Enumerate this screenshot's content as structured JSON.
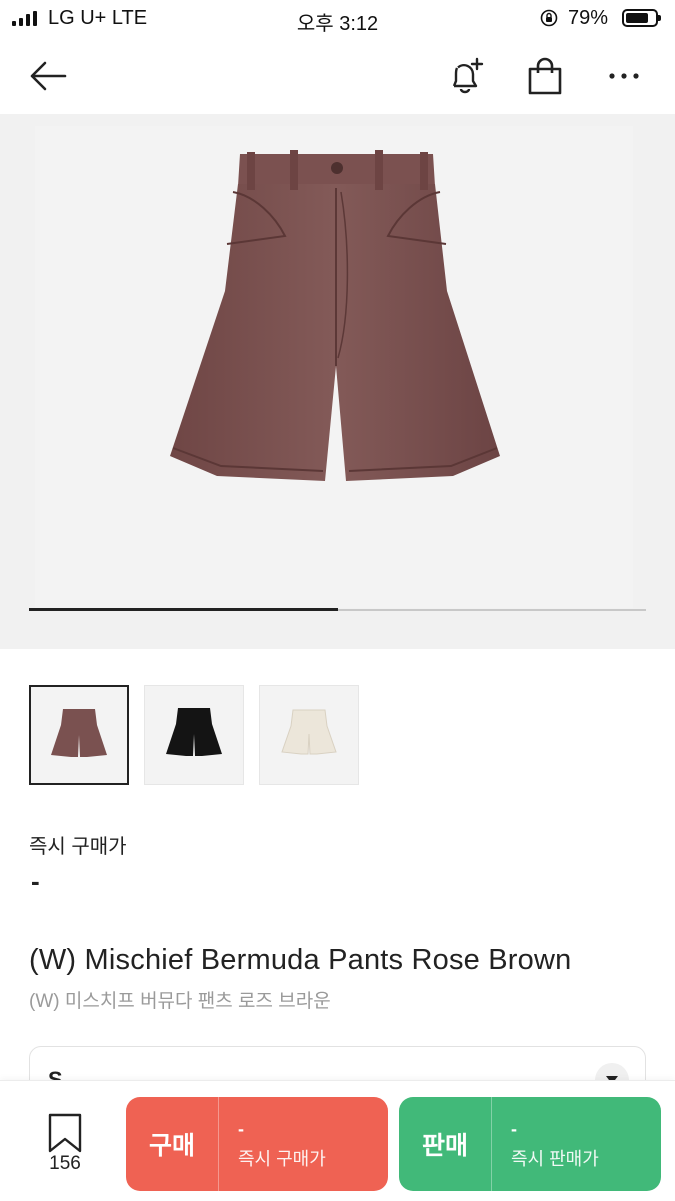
{
  "status_bar": {
    "carrier": "LG U+   LTE",
    "time": "오후 3:12",
    "battery": "79%",
    "battery_level": 0.79
  },
  "nav": {
    "back_icon": "arrow-left-icon",
    "alert_icon": "bell-plus-icon",
    "cart_icon": "shopping-bag-icon",
    "more_icon": "more-horizontal-icon"
  },
  "gallery": {
    "slide_progress": 0.5,
    "background_color": "#f1f1f1",
    "thumbnails": [
      {
        "color": "#7a5150",
        "selected": true
      },
      {
        "color": "#141414",
        "selected": false
      },
      {
        "color": "#ece6da",
        "selected": false
      }
    ]
  },
  "price": {
    "label": "즉시 구매가",
    "value": "-"
  },
  "product": {
    "title_en": "(W) Mischief Bermuda Pants Rose Brown",
    "title_ko": "(W) 미스치프 버뮤다 팬츠 로즈 브라운"
  },
  "size_select": {
    "value": "S",
    "icon": "chevron-down-icon"
  },
  "bottom_bar": {
    "wish_icon": "bookmark-icon",
    "wish_count": "156",
    "buy": {
      "label": "구매",
      "price": "-",
      "sub": "즉시 구매가",
      "color": "#ef6253"
    },
    "sell": {
      "label": "판매",
      "price": "-",
      "sub": "즉시 판매가",
      "color": "#41b979"
    }
  }
}
